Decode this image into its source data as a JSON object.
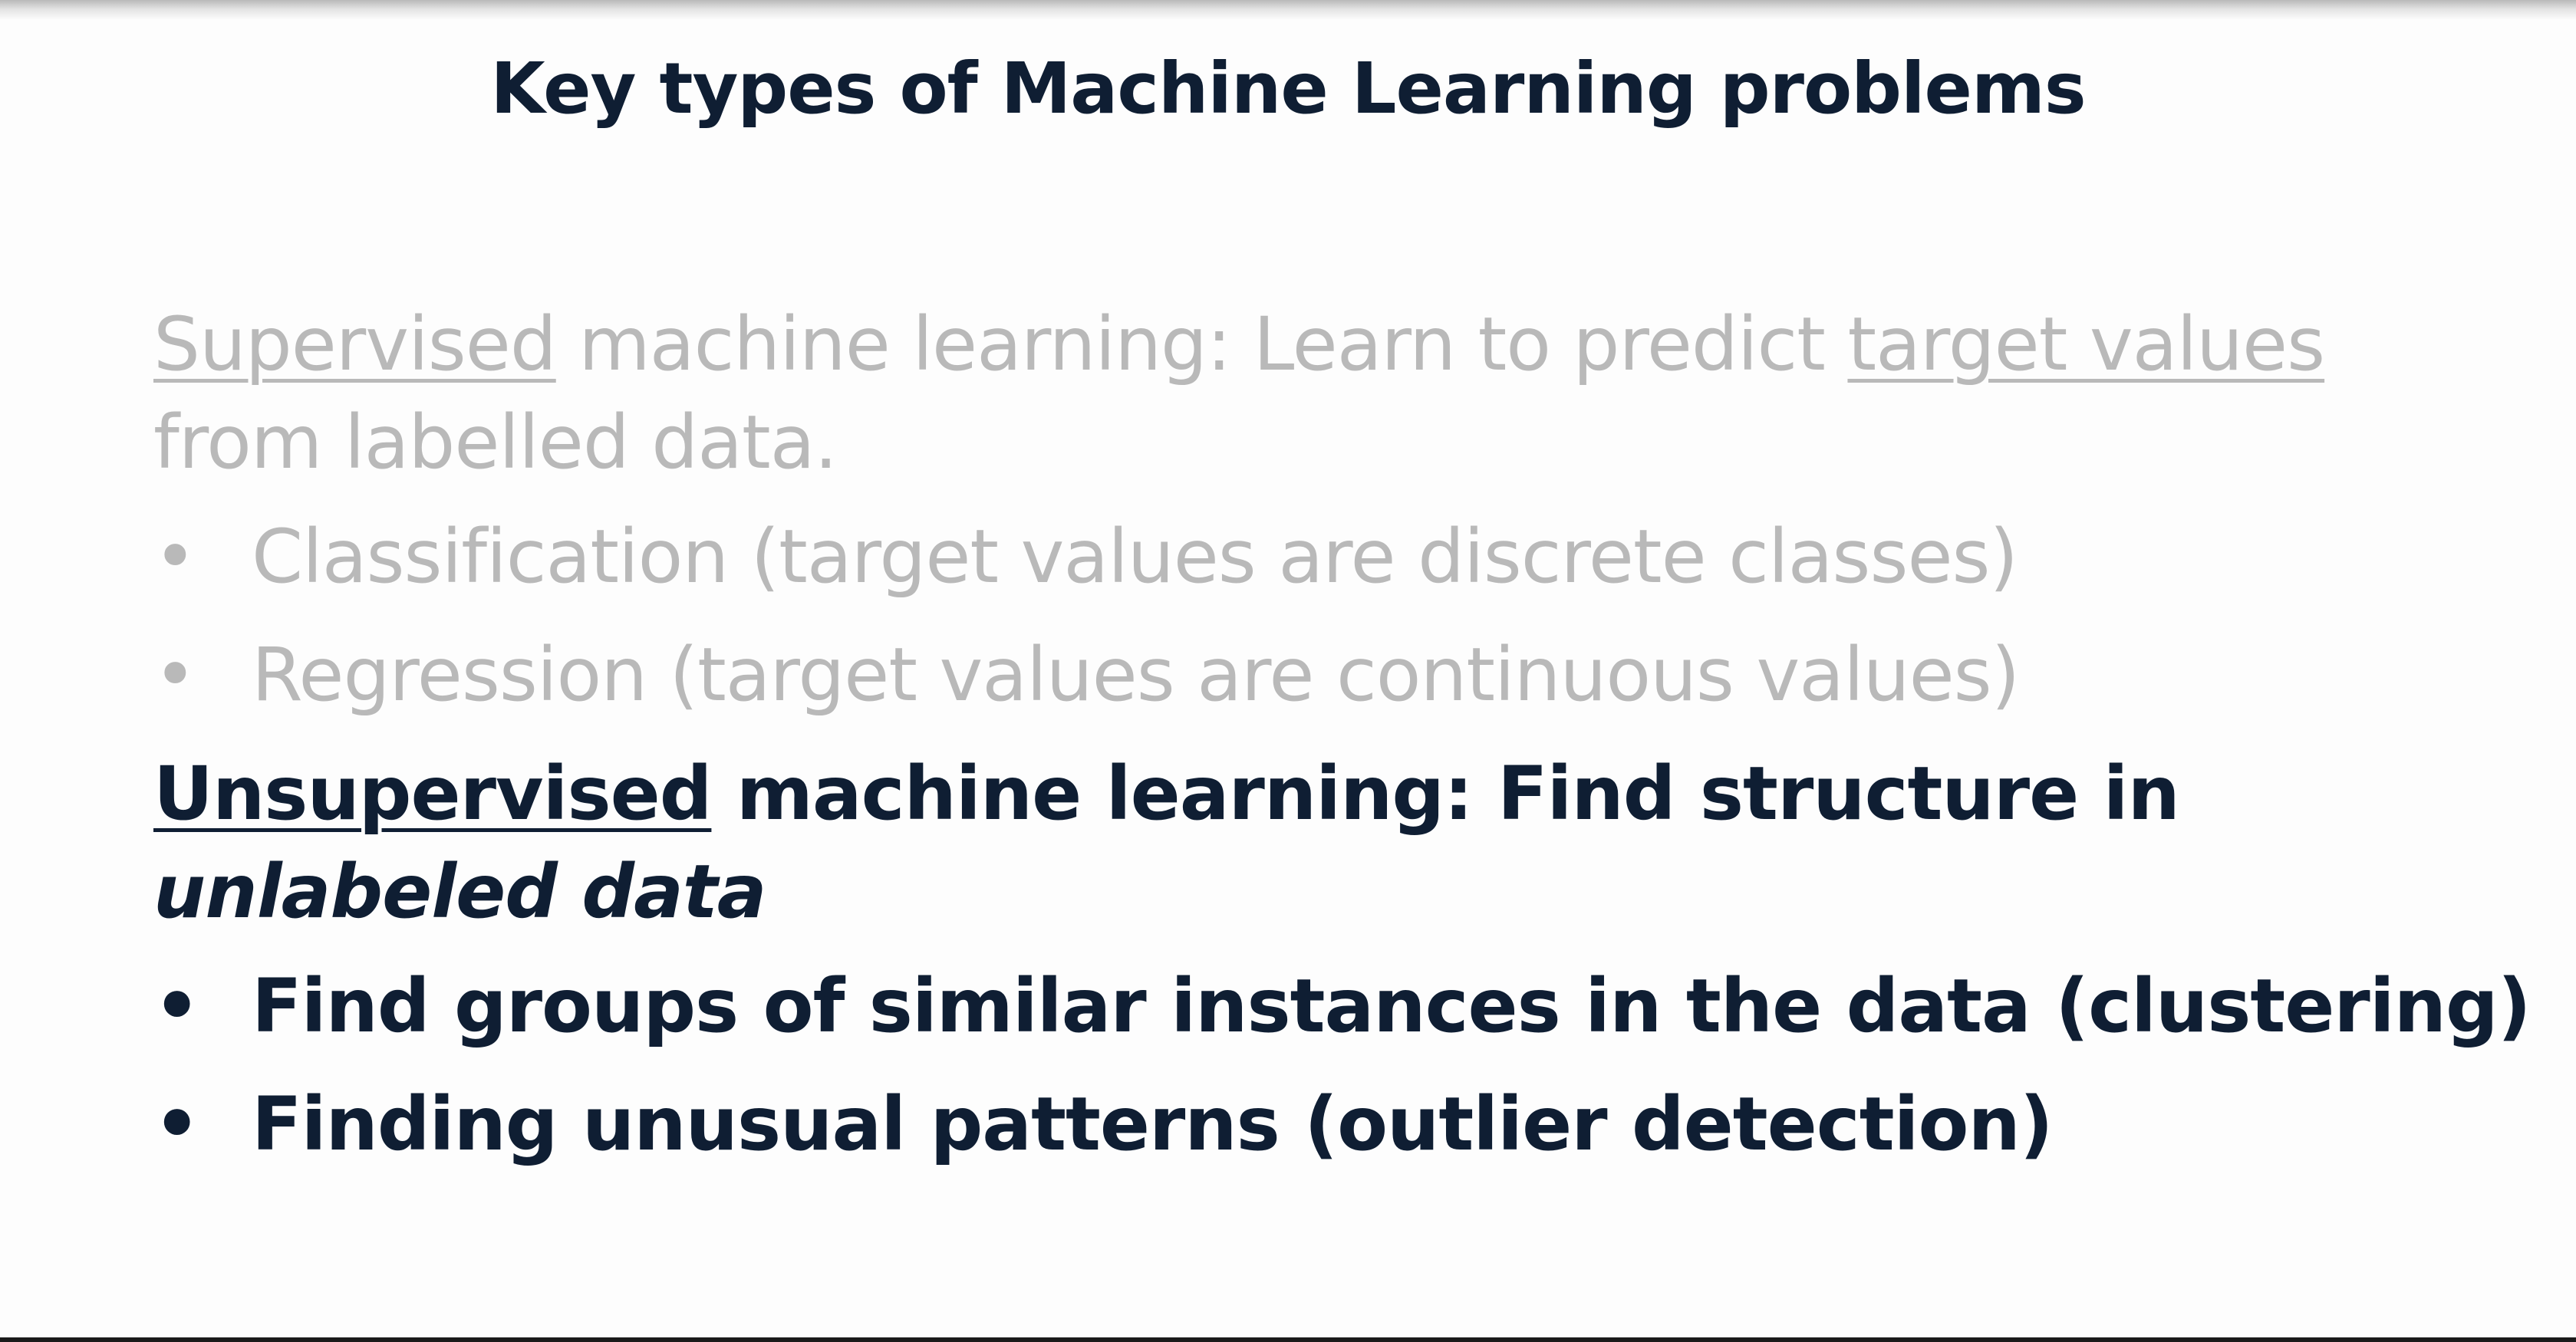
{
  "title": "Key types of Machine Learning problems",
  "supervised": {
    "term": "Supervised",
    "text_1": " machine learning: Learn to predict ",
    "target": "target values",
    "text_2": " from labelled data.",
    "bullets": [
      "Classification  (target values are discrete classes)",
      "Regression (target values are continuous values)"
    ]
  },
  "unsupervised": {
    "term": "Unsupervised",
    "text_1": " machine learning: Find structure in ",
    "italic": "unlabeled data",
    "bullets": [
      "Find groups of similar instances in the data (clustering)",
      "Finding unusual patterns (outlier detection)"
    ]
  },
  "bullet_glyph": "•",
  "colors": {
    "dark_text": "#0f1e33",
    "muted_text": "#b9b9b9",
    "background": "#fdfdfd"
  }
}
